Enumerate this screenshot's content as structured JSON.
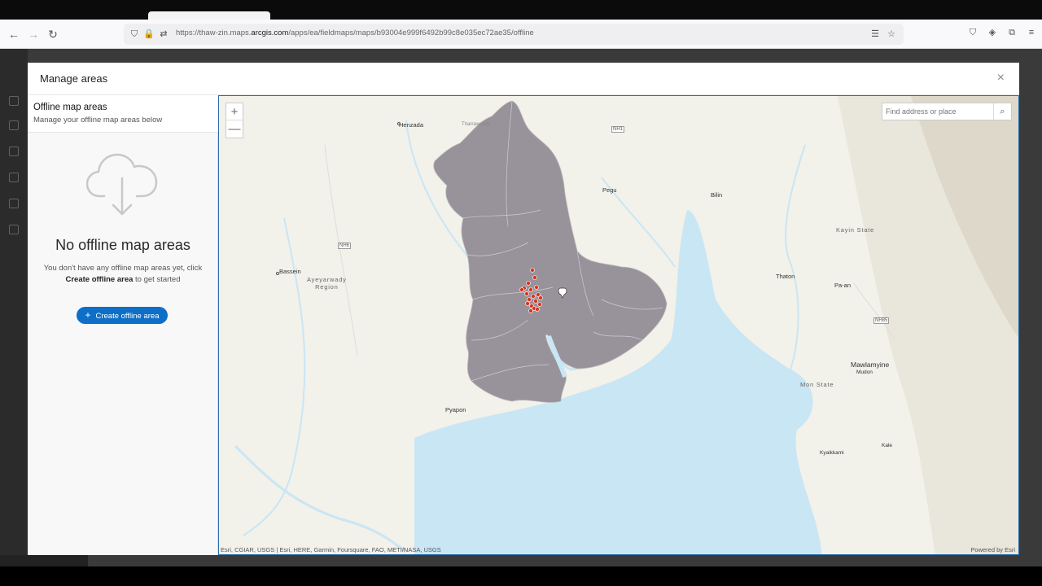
{
  "browser": {
    "url_prefix": "https://thaw-zin.maps.",
    "url_domain": "arcgis.com",
    "url_path": "/apps/ea/fieldmaps/maps/b93004e999f6492b99c8e035ec72ae35/offline"
  },
  "modal": {
    "title": "Manage areas",
    "close_label": "×"
  },
  "panel": {
    "title": "Offline map areas",
    "subtitle": "Manage your offline map areas below",
    "empty_title": "No offline map areas",
    "empty_desc_1": "You don't have any offline map areas yet, click",
    "empty_desc_bold": "Create offline area",
    "empty_desc_2": " to get started",
    "create_button": "Create offline area"
  },
  "map": {
    "search_placeholder": "Find address or place",
    "zoom_in": "+",
    "zoom_out": "—",
    "attribution": "Esri, CGIAR, USGS | Esri, HERE, Garmin, Foursquare, FAO, METI/NASA, USGS",
    "powered_by": "Powered by Esri",
    "places": {
      "henzada": "Henzada",
      "pegu": "Pegu",
      "bilin": "Bilin",
      "bassein": "Bassein",
      "thaton": "Thaton",
      "paan": "Pa-an",
      "mawlamyine": "Mawlamyine",
      "mudon": "Mudon",
      "pyapon": "Pyapon",
      "kyaikkami": "Kyaikkami",
      "kale": "Kale",
      "tharrawaddy": "Tharrawaddy"
    },
    "regions": {
      "ayeyarwady_1": "Ayeyarwady",
      "ayeyarwady_2": "Region",
      "kayin": "Kayin State",
      "mon": "Mon State"
    },
    "roads": {
      "nh6": "NH6",
      "nh1": "NH1",
      "nh85": "NH85"
    },
    "colors": {
      "selected_area": "#98939b",
      "water": "#c9e6f5",
      "points": "#d9341f"
    }
  }
}
